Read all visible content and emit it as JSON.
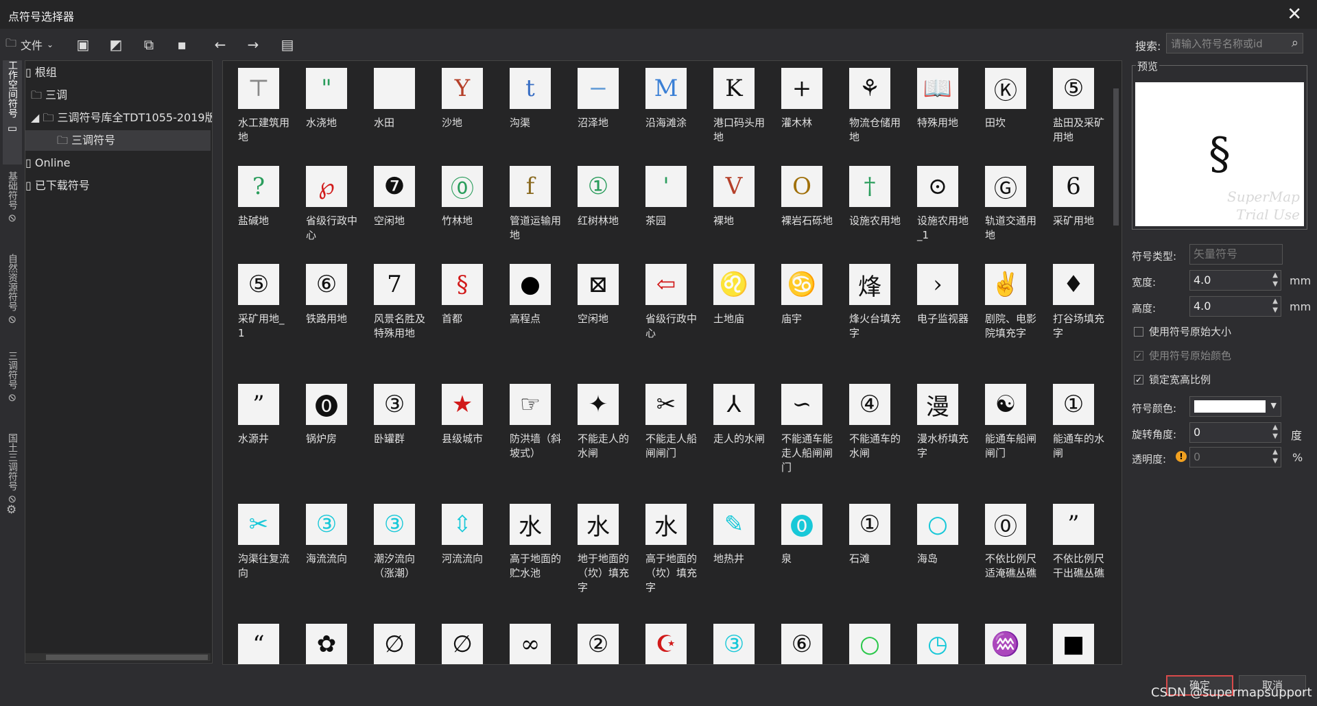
{
  "window": {
    "title": "点符号选择器",
    "close_glyph": "✕"
  },
  "toolbar": {
    "file_label": "文件",
    "buttons": [
      {
        "name": "new-group-icon",
        "glyph": "▣"
      },
      {
        "name": "edit-symbol-icon",
        "glyph": "◩"
      },
      {
        "name": "import-icon",
        "glyph": "⧉"
      },
      {
        "name": "delete-icon",
        "glyph": "▪"
      },
      {
        "name": "back-icon",
        "glyph": "←"
      },
      {
        "name": "forward-icon",
        "glyph": "→"
      },
      {
        "name": "list-icon",
        "glyph": "▤"
      }
    ],
    "search_label": "搜索:",
    "search_placeholder": "请输入符号名称或id"
  },
  "vtabs": [
    {
      "label": "工作空间符号",
      "active": true
    },
    {
      "label": "基础符号",
      "active": false
    },
    {
      "label": "自然资源符号",
      "active": false
    },
    {
      "label": "三调符号",
      "active": false
    },
    {
      "label": "国土三调符号",
      "active": false
    }
  ],
  "tree": [
    {
      "label": "根组",
      "depth": 0,
      "prefix": "▯",
      "selected": false
    },
    {
      "label": "三调",
      "depth": 1,
      "prefix": "🗀",
      "selected": false
    },
    {
      "label": "三调符号库全TDT1055-2019版",
      "depth": 1,
      "prefix": "◢ 🗀",
      "selected": false
    },
    {
      "label": "三调符号",
      "depth": 2,
      "prefix": "🗀",
      "selected": true
    },
    {
      "label": "Online",
      "depth": 0,
      "prefix": "▯",
      "selected": false
    },
    {
      "label": "已下载符号",
      "depth": 0,
      "prefix": "▯",
      "selected": false
    }
  ],
  "symbols": [
    {
      "label": "水工建筑用地",
      "glyph": "⊤",
      "color": "#888"
    },
    {
      "label": "水浇地",
      "glyph": "\"",
      "color": "#2a9d5c"
    },
    {
      "label": "水田",
      "glyph": "",
      "color": "#111"
    },
    {
      "label": "沙地",
      "glyph": "Y",
      "color": "#b5402a"
    },
    {
      "label": "沟渠",
      "glyph": "t",
      "color": "#3a6fc4"
    },
    {
      "label": "沼泽地",
      "glyph": "−",
      "color": "#6aa0d8"
    },
    {
      "label": "沿海滩涂",
      "glyph": "M",
      "color": "#3a7fd5"
    },
    {
      "label": "港口码头用地",
      "glyph": "K",
      "color": "#111"
    },
    {
      "label": "灌木林",
      "glyph": "+",
      "color": "#111"
    },
    {
      "label": "物流仓储用地",
      "glyph": "⚘",
      "color": "#111"
    },
    {
      "label": "特殊用地",
      "glyph": "📖",
      "color": "#111"
    },
    {
      "label": "田坎",
      "glyph": "Ⓚ",
      "color": "#111"
    },
    {
      "label": "盐田及采矿用地",
      "glyph": "⑤",
      "color": "#111"
    },
    {
      "label": "盐碱地",
      "glyph": "?",
      "color": "#2a9d5c"
    },
    {
      "label": "省级行政中心",
      "glyph": "℘",
      "color": "#d11a1a"
    },
    {
      "label": "空闲地",
      "glyph": "❼",
      "color": "#111"
    },
    {
      "label": "竹林地",
      "glyph": "⓪",
      "color": "#2a9d5c"
    },
    {
      "label": "管道运输用地",
      "glyph": "f",
      "color": "#8a6a20"
    },
    {
      "label": "红树林地",
      "glyph": "①",
      "color": "#2a9d5c"
    },
    {
      "label": "茶园",
      "glyph": "'",
      "color": "#2a9d5c"
    },
    {
      "label": "裸地",
      "glyph": "V",
      "color": "#b5402a"
    },
    {
      "label": "裸岩石砾地",
      "glyph": "O",
      "color": "#a0700a"
    },
    {
      "label": "设施农用地",
      "glyph": "†",
      "color": "#2a9d5c"
    },
    {
      "label": "设施农用地_1",
      "glyph": "⊙",
      "color": "#111"
    },
    {
      "label": "轨道交通用地",
      "glyph": "Ⓖ",
      "color": "#111"
    },
    {
      "label": "采矿用地",
      "glyph": "6",
      "color": "#111"
    },
    {
      "label": "采矿用地_1",
      "glyph": "⑤",
      "color": "#111"
    },
    {
      "label": "铁路用地",
      "glyph": "⑥",
      "color": "#111"
    },
    {
      "label": "风景名胜及特殊用地",
      "glyph": "7",
      "color": "#111"
    },
    {
      "label": "首都",
      "glyph": "§",
      "color": "#d11a1a"
    },
    {
      "label": "高程点",
      "glyph": "●",
      "color": "#000"
    },
    {
      "label": "空闲地",
      "glyph": "⊠",
      "color": "#111"
    },
    {
      "label": "省级行政中心",
      "glyph": "⇦",
      "color": "#d11a1a"
    },
    {
      "label": "土地庙",
      "glyph": "♌",
      "color": "#111"
    },
    {
      "label": "庙宇",
      "glyph": "♋",
      "color": "#111"
    },
    {
      "label": "烽火台填充字",
      "glyph": "烽",
      "color": "#111"
    },
    {
      "label": "电子监视器",
      "glyph": "›",
      "color": "#111"
    },
    {
      "label": "剧院、电影院填充字",
      "glyph": "✌",
      "color": "#111"
    },
    {
      "label": "打谷场填充字",
      "glyph": "♦",
      "color": "#111"
    },
    {
      "label": "水源井",
      "glyph": "”",
      "color": "#111"
    },
    {
      "label": "锅炉房",
      "glyph": "⓿",
      "color": "#111"
    },
    {
      "label": "卧罐群",
      "glyph": "③",
      "color": "#111"
    },
    {
      "label": "县级城市",
      "glyph": "★",
      "color": "#d11a1a"
    },
    {
      "label": "防洪墙（斜坡式）",
      "glyph": "☞",
      "color": "#111"
    },
    {
      "label": "不能走人的水闸",
      "glyph": "✦",
      "color": "#111"
    },
    {
      "label": "不能走人船闸闸门",
      "glyph": "✂",
      "color": "#111"
    },
    {
      "label": "走人的水闸",
      "glyph": "⅄",
      "color": "#111"
    },
    {
      "label": "不能通车能走人船闸闸门",
      "glyph": "∽",
      "color": "#111"
    },
    {
      "label": "不能通车的水闸",
      "glyph": "④",
      "color": "#111"
    },
    {
      "label": "漫水桥填充字",
      "glyph": "漫",
      "color": "#111"
    },
    {
      "label": "能通车船闸闸门",
      "glyph": "☯",
      "color": "#111"
    },
    {
      "label": "能通车的水闸",
      "glyph": "①",
      "color": "#111"
    },
    {
      "label": "沟渠往复流向",
      "glyph": "✂",
      "color": "#18c8d8"
    },
    {
      "label": "海流流向",
      "glyph": "③",
      "color": "#18c8d8"
    },
    {
      "label": "潮汐流向（涨潮）",
      "glyph": "③",
      "color": "#18c8d8"
    },
    {
      "label": "河流流向",
      "glyph": "⇳",
      "color": "#18c8d8"
    },
    {
      "label": "高于地面的贮水池",
      "glyph": "水",
      "color": "#111"
    },
    {
      "label": "地于地面的（坎）填充字",
      "glyph": "水",
      "color": "#111"
    },
    {
      "label": "高于地面的（坎）填充字",
      "glyph": "水",
      "color": "#111"
    },
    {
      "label": "地热井",
      "glyph": "✎",
      "color": "#18c8d8"
    },
    {
      "label": "泉",
      "glyph": "⓿",
      "color": "#18c8d8"
    },
    {
      "label": "石滩",
      "glyph": "①",
      "color": "#111"
    },
    {
      "label": "海岛",
      "glyph": "○",
      "color": "#18c8d8"
    },
    {
      "label": "不依比例尺适淹礁丛礁",
      "glyph": "⓪",
      "color": "#111"
    },
    {
      "label": "不依比例尺干出礁丛礁",
      "glyph": "”",
      "color": "#111"
    },
    {
      "label": "",
      "glyph": "“",
      "color": "#111"
    },
    {
      "label": "",
      "glyph": "✿",
      "color": "#111"
    },
    {
      "label": "",
      "glyph": "∅",
      "color": "#111"
    },
    {
      "label": "",
      "glyph": "∅",
      "color": "#111"
    },
    {
      "label": "",
      "glyph": "∞",
      "color": "#111"
    },
    {
      "label": "",
      "glyph": "②",
      "color": "#111"
    },
    {
      "label": "",
      "glyph": "☪",
      "color": "#d11a1a"
    },
    {
      "label": "",
      "glyph": "③",
      "color": "#18c8d8"
    },
    {
      "label": "",
      "glyph": "⑥",
      "color": "#111"
    },
    {
      "label": "",
      "glyph": "○",
      "color": "#2ac84a"
    },
    {
      "label": "",
      "glyph": "◷",
      "color": "#18c8d8"
    },
    {
      "label": "",
      "glyph": "♒",
      "color": "#18c8d8"
    },
    {
      "label": "",
      "glyph": "■",
      "color": "#000"
    }
  ],
  "preview": {
    "label": "预览",
    "glyph": "§",
    "watermark": "SuperMap Trial Use"
  },
  "props": {
    "type_label": "符号类型:",
    "type_value": "矢量符号",
    "width_label": "宽度:",
    "width_value": "4.0",
    "width_unit": "mm",
    "height_label": "高度:",
    "height_value": "4.0",
    "height_unit": "mm",
    "use_original_size": "使用符号原始大小",
    "use_original_color": "使用符号原始颜色",
    "lock_ratio": "锁定宽高比例",
    "color_label": "符号颜色:",
    "color_value": "#ffffff",
    "rotation_label": "旋转角度:",
    "rotation_value": "0",
    "rotation_unit": "度",
    "opacity_label": "透明度:",
    "opacity_value": "0",
    "opacity_unit": "%"
  },
  "buttons": {
    "ok": "确定",
    "cancel": "取消"
  },
  "credit": "CSDN @supermapsupport"
}
